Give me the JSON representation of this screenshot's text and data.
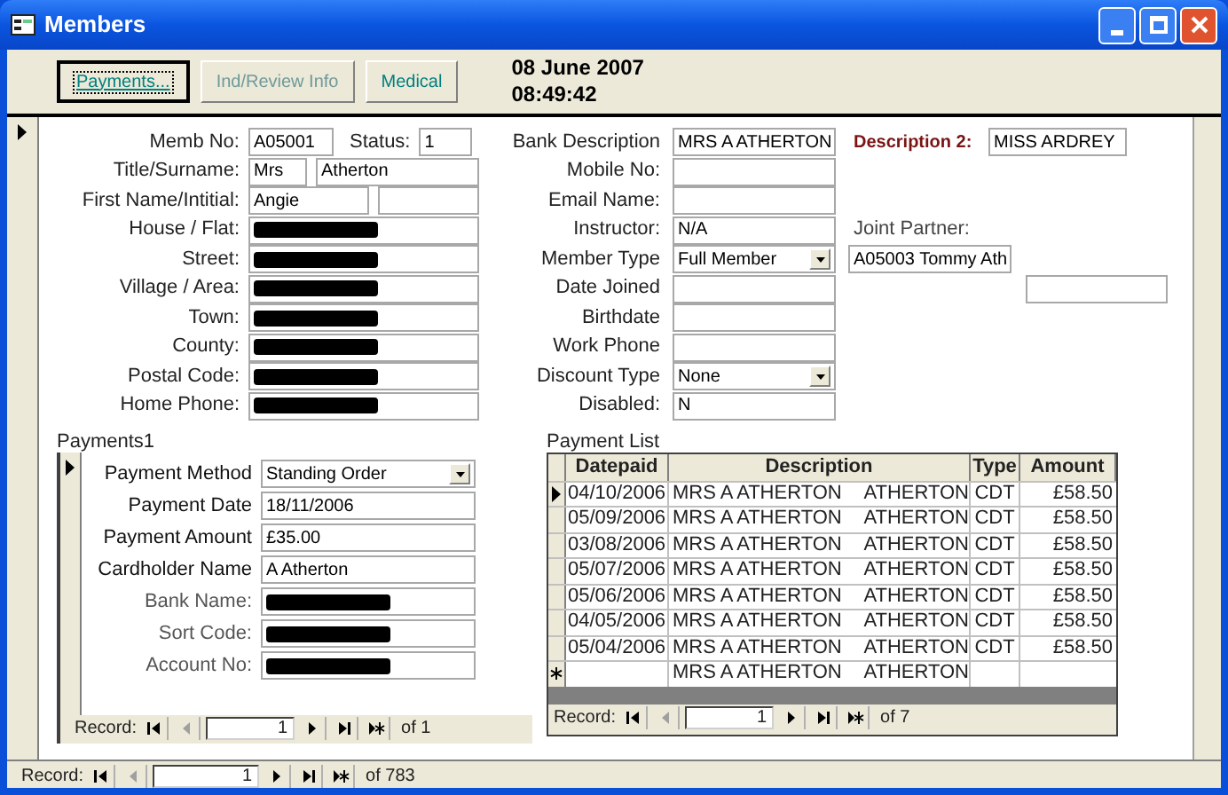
{
  "window": {
    "title": "Members"
  },
  "toolbar": {
    "buttons": [
      {
        "label": "Payments...",
        "focused": true,
        "disabled": false
      },
      {
        "label": "Ind/Review Info",
        "focused": false,
        "disabled": true
      },
      {
        "label": "Medical",
        "focused": false,
        "disabled": false
      }
    ],
    "date": "08 June 2007",
    "time": "08:49:42"
  },
  "member_form": {
    "left_fields": [
      {
        "label": "Memb No:",
        "inputs": [
          {
            "value": "A05001",
            "redacted": false
          },
          {
            "label": "Status:",
            "value": "1",
            "redacted": false
          }
        ]
      },
      {
        "label": "Title/Surname:",
        "inputs": [
          {
            "value": "Mrs",
            "redacted": false
          },
          {
            "value": "Atherton",
            "redacted": false
          }
        ]
      },
      {
        "label": "First Name/Intitial:",
        "inputs": [
          {
            "value": "Angie",
            "redacted": false
          },
          {
            "redacted": false
          }
        ]
      },
      {
        "label": "House / Flat:",
        "inputs": [
          {
            "redacted": true
          }
        ]
      },
      {
        "label": "Street:",
        "inputs": [
          {
            "redacted": true
          }
        ]
      },
      {
        "label": "Village / Area:",
        "inputs": [
          {
            "redacted": true
          }
        ]
      },
      {
        "label": "Town:",
        "inputs": [
          {
            "redacted": true
          }
        ]
      },
      {
        "label": "County:",
        "inputs": [
          {
            "redacted": true
          }
        ]
      },
      {
        "label": "Postal Code:",
        "inputs": [
          {
            "redacted": true
          }
        ]
      },
      {
        "label": "Home Phone:",
        "inputs": [
          {
            "redacted": true
          }
        ]
      }
    ],
    "right_fields": [
      {
        "label": "Bank Description",
        "kind": "text",
        "value": "MRS A ATHERTON",
        "extras": [
          {
            "kind": "heading",
            "text": "Description 2:"
          },
          {
            "kind": "input",
            "value": "MISS ARDREY"
          }
        ]
      },
      {
        "label": "Mobile No:",
        "kind": "text"
      },
      {
        "label": "Email Name:",
        "kind": "text"
      },
      {
        "label": "Instructor:",
        "kind": "text",
        "value": "N/A",
        "extras": [
          {
            "kind": "label",
            "text": "Joint Partner:"
          }
        ]
      },
      {
        "label": "Member Type",
        "kind": "combo",
        "value": "Full Member",
        "extras": [
          {
            "kind": "input",
            "value": "A05003 Tommy Ath"
          }
        ]
      },
      {
        "label": "Date Joined",
        "kind": "text",
        "extras": [
          {
            "kind": "far_input"
          }
        ]
      },
      {
        "label": "Birthdate",
        "kind": "text"
      },
      {
        "label": "Work Phone",
        "kind": "text"
      },
      {
        "label": "Discount Type",
        "kind": "combo",
        "value": "None"
      },
      {
        "label": "Disabled:",
        "kind": "text",
        "value": "N"
      }
    ]
  },
  "payments_subform": {
    "title": "Payments1",
    "fields": [
      {
        "label": "Payment Method",
        "kind": "combo",
        "value": "Standing Order",
        "muted": false,
        "redacted": false
      },
      {
        "label": "Payment Date",
        "kind": "text",
        "value": "18/11/2006",
        "muted": false,
        "redacted": false
      },
      {
        "label": "Payment Amount",
        "kind": "text",
        "value": "£35.00",
        "muted": false,
        "redacted": false
      },
      {
        "label": "Cardholder Name",
        "kind": "text",
        "value": "A Atherton",
        "muted": false,
        "redacted": false
      },
      {
        "label": "Bank Name:",
        "kind": "text",
        "muted": true,
        "redacted": true
      },
      {
        "label": "Sort Code:",
        "kind": "text",
        "muted": true,
        "redacted": true
      },
      {
        "label": "Account No:",
        "kind": "text",
        "muted": true,
        "redacted": true
      }
    ],
    "navigation": {
      "label": "Record:",
      "current": "1",
      "total": "of 1"
    }
  },
  "payment_list": {
    "title": "Payment List",
    "columns": [
      "Datepaid",
      "Description",
      "Type",
      "Amount"
    ],
    "rows": [
      {
        "kind": "record",
        "current": true,
        "datepaid": "04/10/2006",
        "description": [
          "MRS A ATHERTON",
          "ATHERTON"
        ],
        "type": "CDT",
        "amount": "£58.50"
      },
      {
        "kind": "record",
        "current": false,
        "datepaid": "05/09/2006",
        "description": [
          "MRS A ATHERTON",
          "ATHERTON"
        ],
        "type": "CDT",
        "amount": "£58.50"
      },
      {
        "kind": "record",
        "current": false,
        "datepaid": "03/08/2006",
        "description": [
          "MRS A ATHERTON",
          "ATHERTON"
        ],
        "type": "CDT",
        "amount": "£58.50"
      },
      {
        "kind": "record",
        "current": false,
        "datepaid": "05/07/2006",
        "description": [
          "MRS A ATHERTON",
          "ATHERTON"
        ],
        "type": "CDT",
        "amount": "£58.50"
      },
      {
        "kind": "record",
        "current": false,
        "datepaid": "05/06/2006",
        "description": [
          "MRS A ATHERTON",
          "ATHERTON"
        ],
        "type": "CDT",
        "amount": "£58.50"
      },
      {
        "kind": "record",
        "current": false,
        "datepaid": "04/05/2006",
        "description": [
          "MRS A ATHERTON",
          "ATHERTON"
        ],
        "type": "CDT",
        "amount": "£58.50"
      },
      {
        "kind": "record",
        "current": false,
        "datepaid": "05/04/2006",
        "description": [
          "MRS A ATHERTON",
          "ATHERTON"
        ],
        "type": "CDT",
        "amount": "£58.50"
      },
      {
        "kind": "new",
        "current": false,
        "description": [
          "MRS A ATHERTON",
          "ATHERTON"
        ]
      }
    ],
    "navigation": {
      "label": "Record:",
      "current": "1",
      "total": "of 7"
    }
  },
  "navigation": {
    "label": "Record:",
    "current": "1",
    "total": "of 783"
  }
}
